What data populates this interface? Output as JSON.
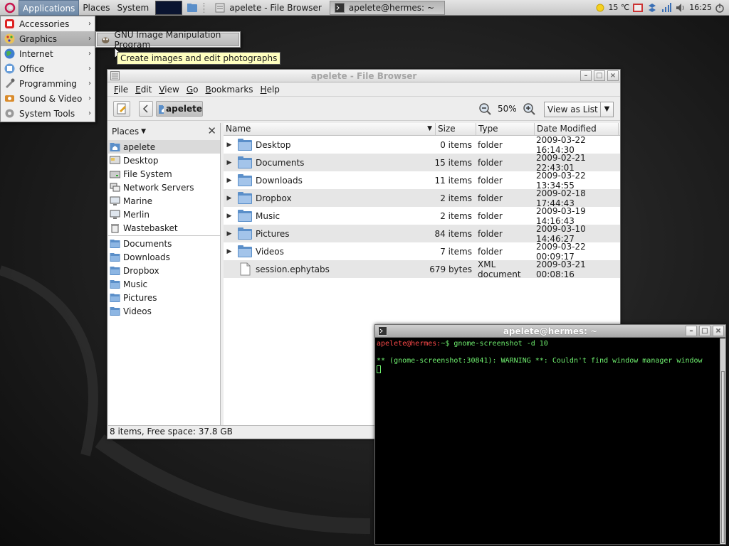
{
  "panel": {
    "menus": [
      "Applications",
      "Places",
      "System"
    ],
    "tasks": [
      {
        "label": "apelete - File Browser"
      },
      {
        "label": "apelete@hermes: ~"
      }
    ],
    "weather": "15 ℃",
    "clock": "16:25"
  },
  "app_menu": {
    "items": [
      {
        "label": "Accessories",
        "icon": "accessories-icon"
      },
      {
        "label": "Graphics",
        "icon": "graphics-icon"
      },
      {
        "label": "Internet",
        "icon": "internet-icon"
      },
      {
        "label": "Office",
        "icon": "office-icon"
      },
      {
        "label": "Programming",
        "icon": "programming-icon"
      },
      {
        "label": "Sound & Video",
        "icon": "sound-video-icon"
      },
      {
        "label": "System Tools",
        "icon": "system-tools-icon"
      }
    ],
    "submenu_item": "GNU Image Manipulation Program",
    "tooltip": "Create images and edit photographs"
  },
  "file_browser": {
    "title": "apelete - File Browser",
    "menubar": [
      "File",
      "Edit",
      "View",
      "Go",
      "Bookmarks",
      "Help"
    ],
    "location_button": "apelete",
    "zoom": "50%",
    "view_mode": "View as List",
    "sidebar_title": "Places",
    "places": [
      {
        "label": "apelete",
        "icon": "home-folder-icon"
      },
      {
        "label": "Desktop",
        "icon": "desktop-icon"
      },
      {
        "label": "File System",
        "icon": "drive-icon"
      },
      {
        "label": "Network Servers",
        "icon": "network-icon"
      },
      {
        "label": "Marine",
        "icon": "computer-icon"
      },
      {
        "label": "Merlin",
        "icon": "computer-icon"
      },
      {
        "label": "Wastebasket",
        "icon": "trash-icon"
      }
    ],
    "bookmarks": [
      "Documents",
      "Downloads",
      "Dropbox",
      "Music",
      "Pictures",
      "Videos"
    ],
    "columns": [
      "Name",
      "Size",
      "Type",
      "Date Modified"
    ],
    "files": [
      {
        "name": "Desktop",
        "size": "0 items",
        "type": "folder",
        "date": "2009-03-22 16:14:30",
        "kind": "folder"
      },
      {
        "name": "Documents",
        "size": "15 items",
        "type": "folder",
        "date": "2009-02-21 22:43:01",
        "kind": "folder"
      },
      {
        "name": "Downloads",
        "size": "11 items",
        "type": "folder",
        "date": "2009-03-22 13:34:55",
        "kind": "folder"
      },
      {
        "name": "Dropbox",
        "size": "2 items",
        "type": "folder",
        "date": "2009-02-18 17:44:43",
        "kind": "folder"
      },
      {
        "name": "Music",
        "size": "2 items",
        "type": "folder",
        "date": "2009-03-19 14:16:43",
        "kind": "folder"
      },
      {
        "name": "Pictures",
        "size": "84 items",
        "type": "folder",
        "date": "2009-03-10 14:46:27",
        "kind": "folder"
      },
      {
        "name": "Videos",
        "size": "7 items",
        "type": "folder",
        "date": "2009-03-22 00:09:17",
        "kind": "folder"
      },
      {
        "name": "session.ephytabs",
        "size": "679 bytes",
        "type": "XML document",
        "date": "2009-03-21 00:08:16",
        "kind": "file"
      }
    ],
    "status": "8 items, Free space: 37.8 GB"
  },
  "terminal": {
    "title": "apelete@hermes: ~",
    "prompt_user": "apelete@hermes:",
    "prompt_rest": "~$ gnome-screenshot -d 10",
    "warning": "** (gnome-screenshot:30841): WARNING **: Couldn't find window manager window"
  },
  "colors": {
    "folder_blue": "#5b8fc9",
    "terminal_green": "#6ff06f",
    "terminal_user": "#ff4a4a",
    "tooltip_bg": "#ffffbf"
  }
}
